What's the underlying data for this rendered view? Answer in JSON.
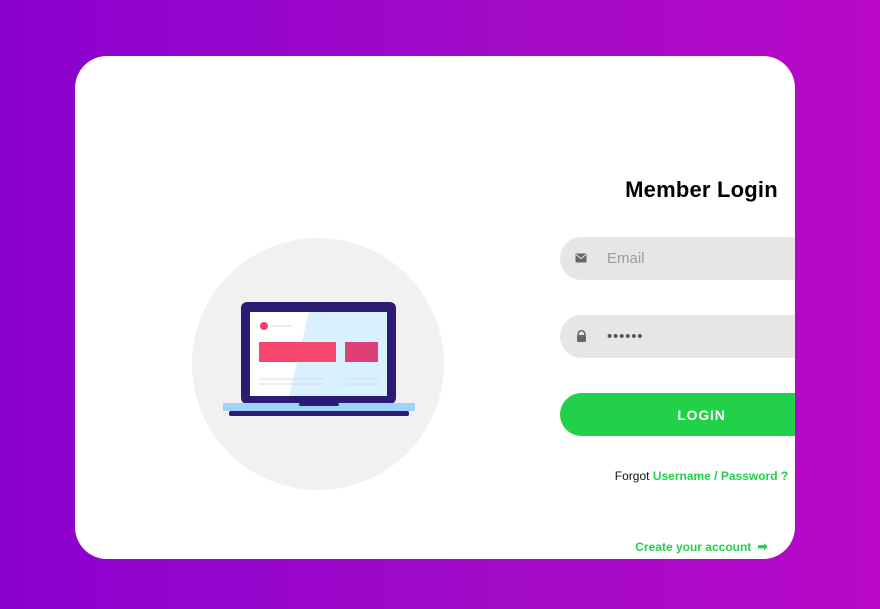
{
  "login": {
    "title": "Member Login",
    "email_placeholder": "Email",
    "password_value": "••••••",
    "button_label": "LOGIN",
    "forgot_prefix": "Forgot",
    "forgot_link": "Username / Password ?",
    "create_account": "Create your account",
    "create_arrow": "➡"
  },
  "icons": {
    "email": "envelope-icon",
    "password": "lock-icon",
    "laptop": "laptop-illustration"
  },
  "colors": {
    "background_start": "#8b00cf",
    "background_end": "#b807c7",
    "card": "#ffffff",
    "field": "#e6e6e6",
    "accent": "#22d14a",
    "illustration_bg": "#f1f1f1",
    "laptop_frame": "#2b1b73",
    "laptop_base": "#9fd2f6",
    "highlight": "#f2416f"
  }
}
